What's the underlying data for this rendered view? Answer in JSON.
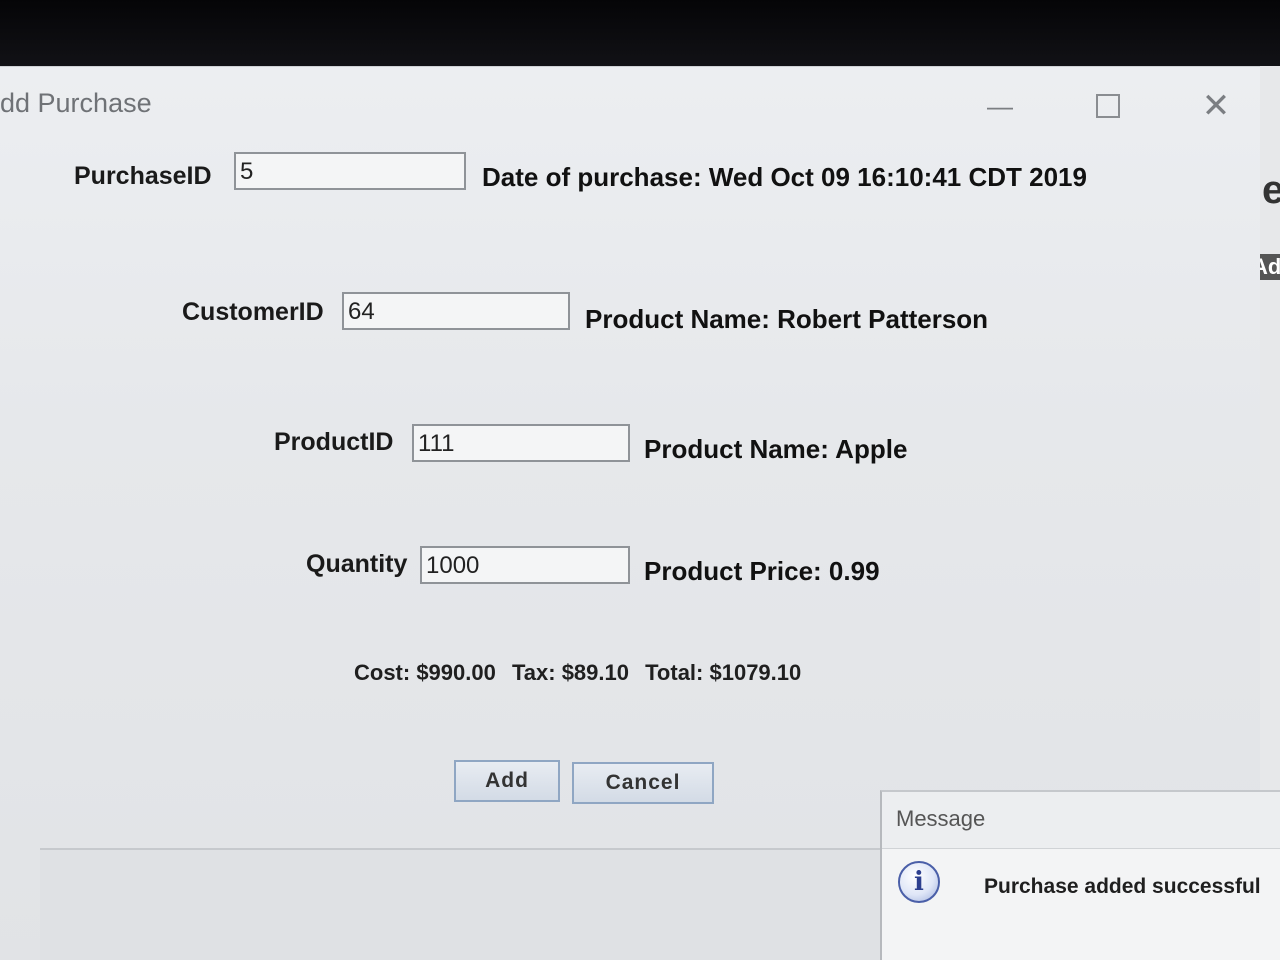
{
  "window": {
    "title": "dd Purchase"
  },
  "title_bar_controls": {
    "minimize": "—",
    "close": "✕"
  },
  "form": {
    "purchase_id_label": "PurchaseID",
    "purchase_id_value": "5",
    "date_text": "Date of purchase: Wed Oct 09 16:10:41 CDT 2019",
    "customer_id_label": "CustomerID",
    "customer_id_value": "64",
    "customer_name_text": "Product Name: Robert Patterson",
    "product_id_label": "ProductID",
    "product_id_value": "111",
    "product_name_text": "Product Name: Apple",
    "quantity_label": "Quantity",
    "quantity_value": "1000",
    "product_price_text": "Product Price: 0.99"
  },
  "summary": {
    "cost": "Cost: $990.00",
    "tax": "Tax: $89.10",
    "total": "Total: $1079.10"
  },
  "buttons": {
    "add": "Add",
    "cancel": "Cancel"
  },
  "background_window": {
    "fragment_top": "e",
    "fragment_mid": "Ad"
  },
  "message_dialog": {
    "title": "Message",
    "icon": "info-icon",
    "icon_glyph": "i",
    "text": "Purchase added successful"
  }
}
